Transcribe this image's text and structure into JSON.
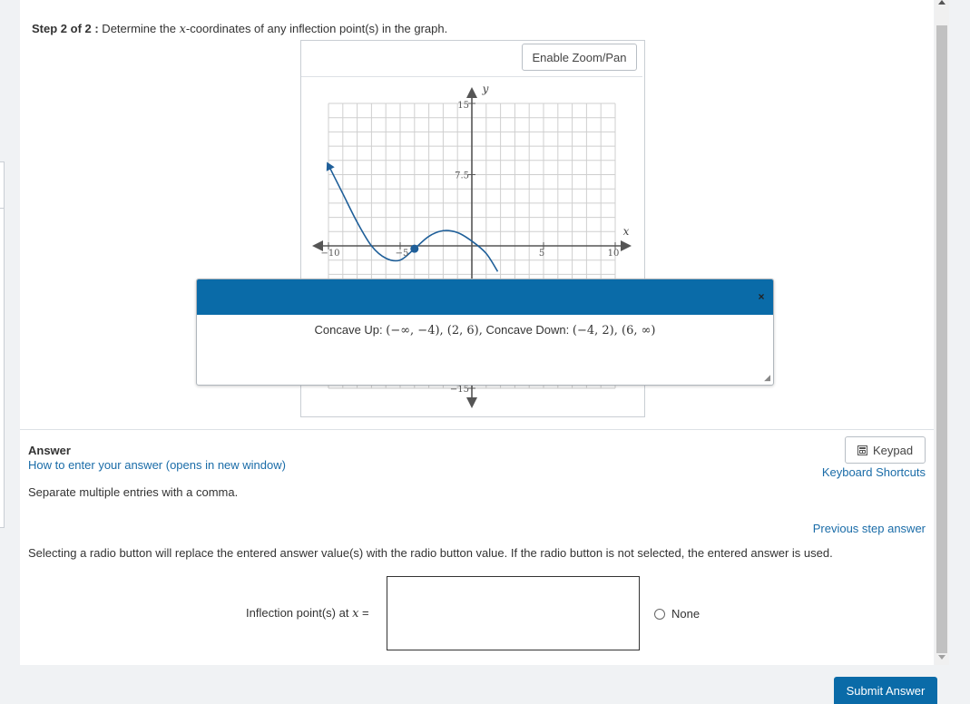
{
  "step": {
    "prefix": "Step 2 of 2 :",
    "text_before": " Determine the ",
    "var": "x",
    "text_after": "-coordinates of any inflection point(s) in the graph."
  },
  "graph": {
    "zoom_button": "Enable Zoom/Pan",
    "x_axis_label": "x",
    "y_axis_label": "y",
    "x_ticks": [
      "−10",
      "−5",
      "5",
      "10"
    ],
    "y_ticks": [
      "15",
      "7.5",
      "−15"
    ]
  },
  "chart_data": {
    "type": "line",
    "title": "",
    "xlabel": "x",
    "ylabel": "y",
    "xlim": [
      -10,
      10
    ],
    "ylim": [
      -15,
      15
    ],
    "grid": true,
    "x_tick_labels": [
      "−10",
      "−5",
      "5",
      "10"
    ],
    "y_tick_labels": [
      "15",
      "7.5",
      "−15"
    ],
    "series": [
      {
        "color": "#1f5f99",
        "points": [
          [
            -10,
            8.5
          ],
          [
            -9,
            5.5
          ],
          [
            -8,
            2.5
          ],
          [
            -7,
            0
          ],
          [
            -6,
            -1.3
          ],
          [
            -5,
            -1.5
          ],
          [
            -4,
            -0.3
          ],
          [
            -3,
            1
          ],
          [
            -2,
            1.6
          ],
          [
            -1,
            1.4
          ],
          [
            0,
            0.5
          ],
          [
            1,
            -0.8
          ],
          [
            1.8,
            -2.7
          ]
        ]
      }
    ],
    "marked_points": [
      [
        -4,
        -0.3
      ]
    ]
  },
  "popup": {
    "close": "×",
    "label_up": "Concave Up: ",
    "math_up": "(−∞, −4), (2, 6),",
    "label_down": " Concave Down: ",
    "math_down": "(−4, 2), (6, ∞)"
  },
  "answer": {
    "heading": "Answer",
    "how_to": "How to enter your answer (opens in new window)",
    "separate_note": "Separate multiple entries with a comma.",
    "keypad": "Keypad",
    "keyboard_shortcuts": "Keyboard Shortcuts",
    "previous_step": "Previous step answer",
    "selecting_note": "Selecting a radio button will replace the entered answer value(s) with the radio button value. If the radio button is not selected, the entered answer is used.",
    "inflection_label": "Inflection point(s) at ",
    "inflection_var": "x",
    "inflection_eq": " =",
    "input_value": "",
    "none_option": "None",
    "submit": "Submit Answer"
  }
}
